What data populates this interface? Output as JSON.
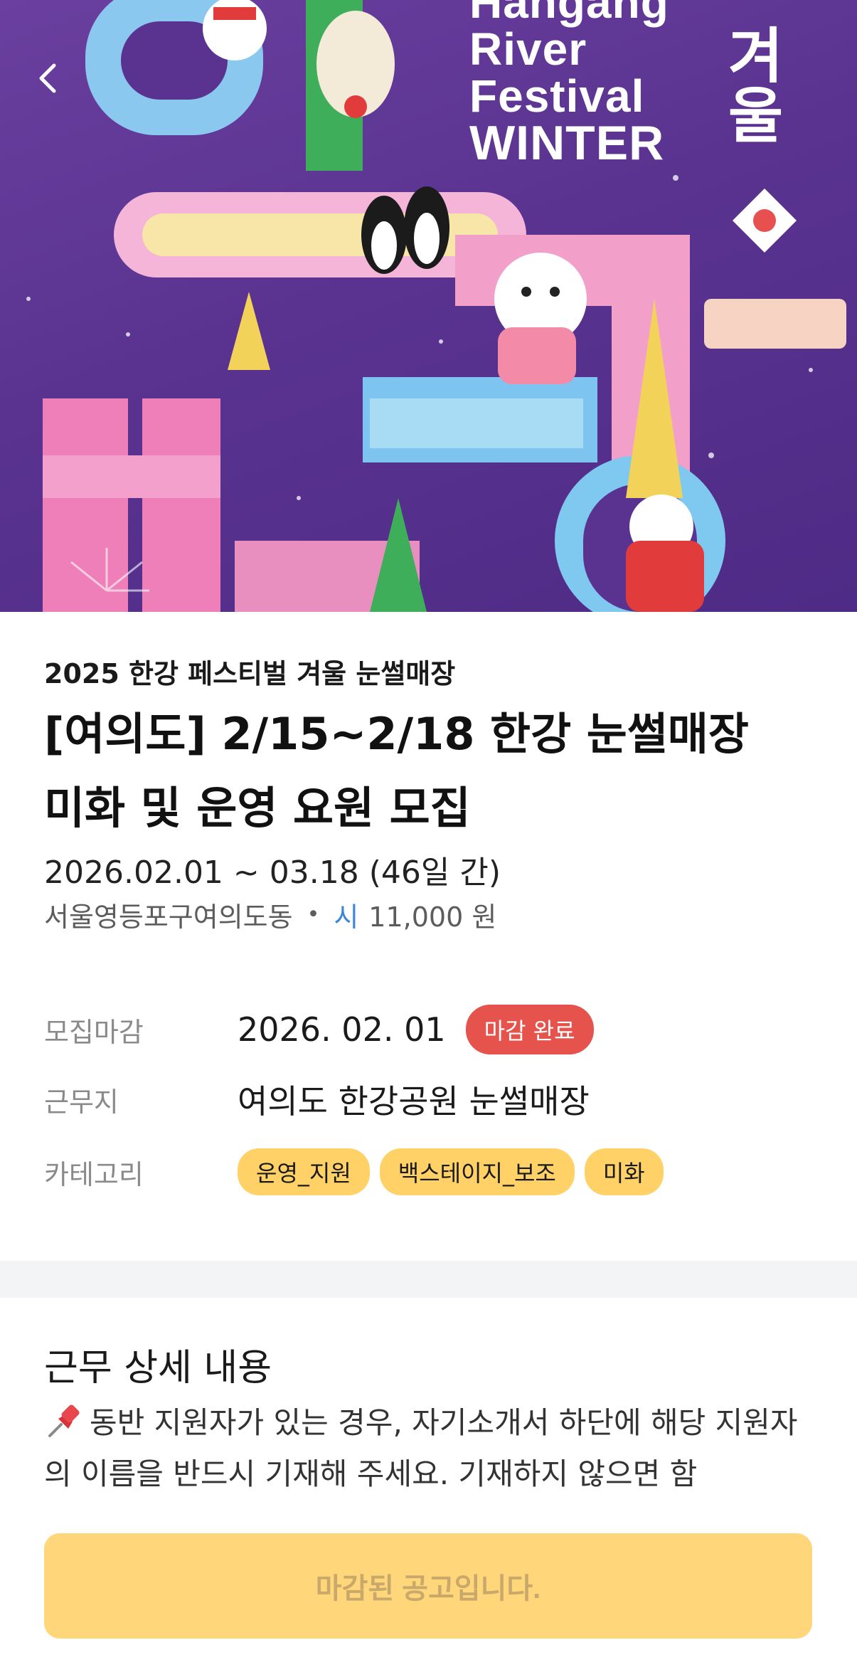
{
  "hero": {
    "poster_lines": [
      "Hangang",
      "River",
      "Festival",
      "WINTER"
    ],
    "poster_korean": "겨울",
    "back_icon": "chevron-left-icon"
  },
  "job": {
    "festival_name": "2025 한강 페스티벌 겨울 눈썰매장",
    "title": "[여의도]  2/15~2/18 한강 눈썰매장 미화 및 운영 요원 모집",
    "period": "2026.02.01 ~ 03.18 (46일 간)",
    "location": "서울영등포구여의도동",
    "separator": "•",
    "wage_unit": "시",
    "wage": "11,000 원"
  },
  "details": {
    "deadline_label": "모집마감",
    "deadline_value": "2026. 02. 01",
    "deadline_badge": "마감 완료",
    "workplace_label": "근무지",
    "workplace_value": "여의도 한강공원 눈썰매장",
    "category_label": "카테고리",
    "categories": [
      "운영_지원",
      "백스테이지_보조",
      "미화"
    ]
  },
  "description": {
    "title": "근무 상세 내용",
    "icon": "pushpin-icon",
    "text": "동반 지원자가 있는 경우, 자기소개서 하단에 해당 지원자의 이름을 반드시 기재해 주세요. 기재하지 않으면 함"
  },
  "footer": {
    "closed_label": "마감된 공고입니다."
  },
  "colors": {
    "poster_purple": "#5a3390",
    "badge_red": "#e6534d",
    "chip_yellow": "#ffd166",
    "button_yellow": "#ffd77a",
    "wage_blue": "#3f86d8"
  }
}
